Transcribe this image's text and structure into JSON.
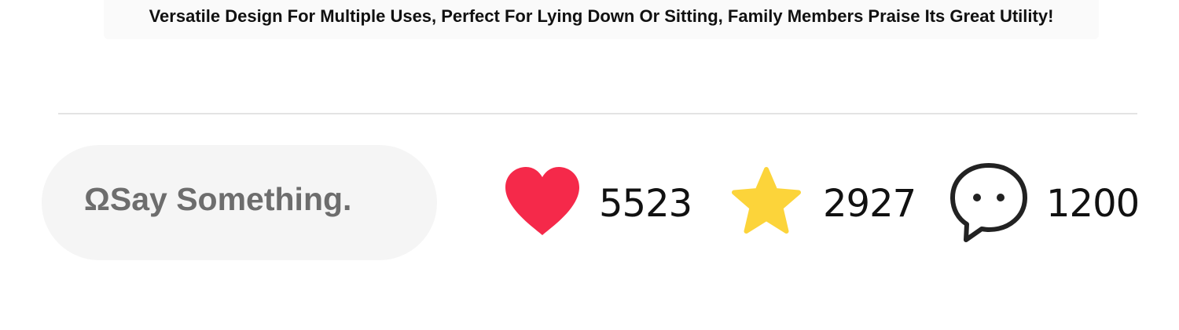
{
  "caption": {
    "text": "Versatile Design For Multiple Uses, Perfect For Lying Down Or Sitting, Family Members Praise Its Great Utility!"
  },
  "comment_box": {
    "placeholder": "ΩSay Something."
  },
  "stats": {
    "likes": {
      "icon": "heart-icon",
      "count": "5523",
      "color": "#f5294a"
    },
    "favorites": {
      "icon": "star-icon",
      "count": "2927",
      "color": "#fcd43a"
    },
    "comments": {
      "icon": "speech-bubble-icon",
      "count": "1200",
      "color": "#222222"
    }
  }
}
